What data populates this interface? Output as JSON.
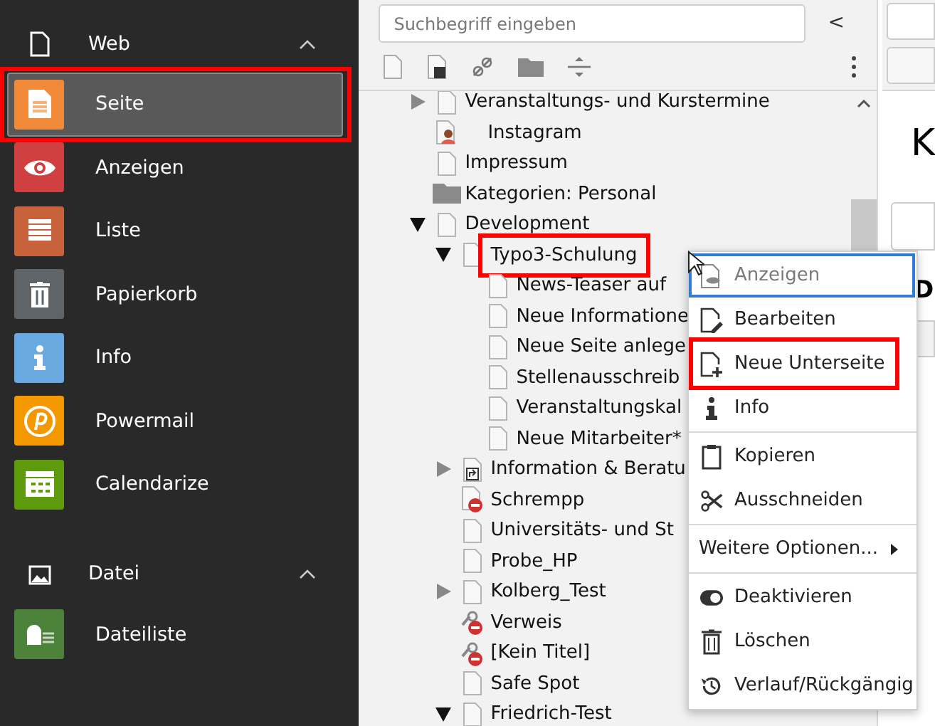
{
  "sidebar": {
    "sections": [
      {
        "title": "Web",
        "expanded": true,
        "kind": "page",
        "items": [
          {
            "label": "Seite",
            "kind": "page",
            "color": "#f08a38",
            "selected": true,
            "highlighted": true
          },
          {
            "label": "Anzeigen",
            "kind": "eye",
            "color": "#d04040",
            "selected": false,
            "highlighted": false
          },
          {
            "label": "Liste",
            "kind": "list",
            "color": "#c8623a",
            "selected": false,
            "highlighted": false
          },
          {
            "label": "Papierkorb",
            "kind": "trash",
            "color": "#5f6468",
            "selected": false,
            "highlighted": false
          },
          {
            "label": "Info",
            "kind": "info",
            "color": "#6aa9e0",
            "selected": false,
            "highlighted": false
          },
          {
            "label": "Powermail",
            "kind": "p",
            "color": "#f39800",
            "selected": false,
            "highlighted": false
          },
          {
            "label": "Calendarize",
            "kind": "calendar",
            "color": "#5d9b0d",
            "selected": false,
            "highlighted": false
          }
        ]
      },
      {
        "title": "Datei",
        "expanded": true,
        "kind": "image",
        "items": [
          {
            "label": "Dateiliste",
            "kind": "cloud",
            "color": "#4c8239",
            "selected": false,
            "highlighted": false
          }
        ]
      }
    ]
  },
  "tree_panel": {
    "search": {
      "placeholder": "Suchbegriff eingeben"
    },
    "collapse_button": "<",
    "nodes": [
      {
        "label": "Veranstaltungs- und Kurstermine",
        "kind": "page",
        "expanded": false,
        "highlighted": false
      },
      {
        "label": "Instagram",
        "kind": "user",
        "highlighted": false
      },
      {
        "label": "Impressum",
        "kind": "page",
        "highlighted": false
      },
      {
        "label": "Kategorien: Personal",
        "kind": "folder",
        "highlighted": false
      },
      {
        "label": "Development",
        "kind": "page",
        "expanded": true,
        "highlighted": false,
        "children": [
          {
            "label": "Typo3-Schulung",
            "kind": "page",
            "expanded": true,
            "highlighted": true,
            "children": [
              {
                "label": "News-Teaser auf",
                "kind": "page",
                "highlighted": false
              },
              {
                "label": "Neue Informatione",
                "kind": "page",
                "highlighted": false
              },
              {
                "label": "Neue Seite anlege",
                "kind": "page",
                "highlighted": false
              },
              {
                "label": "Stellenausschreib",
                "kind": "page",
                "highlighted": false
              },
              {
                "label": "Veranstaltungskal",
                "kind": "page",
                "highlighted": false
              },
              {
                "label": "Neue Mitarbeiter*",
                "kind": "page",
                "highlighted": false
              }
            ]
          },
          {
            "label": "Information & Beratu",
            "kind": "shortcut",
            "expanded": false,
            "highlighted": false
          },
          {
            "label": "Schrempp",
            "kind": "disabled",
            "highlighted": false
          },
          {
            "label": "Universitäts- und St",
            "kind": "page",
            "highlighted": false
          },
          {
            "label": "Probe_HP",
            "kind": "page",
            "highlighted": false
          },
          {
            "label": "Kolberg_Test",
            "kind": "page",
            "expanded": false,
            "highlighted": false
          },
          {
            "label": "Verweis",
            "kind": "link-disabled",
            "highlighted": false
          },
          {
            "label": "[Kein Titel]",
            "kind": "link-disabled",
            "highlighted": false
          },
          {
            "label": "Safe Spot",
            "kind": "page",
            "highlighted": false
          },
          {
            "label": "Friedrich-Test",
            "kind": "page",
            "expanded": true,
            "highlighted": false
          }
        ]
      }
    ]
  },
  "content": {
    "heading": "K",
    "label": "D"
  },
  "context_menu": {
    "groups": [
      [
        {
          "label": "Anzeigen",
          "kind": "view",
          "focused": true,
          "highlighted": false
        },
        {
          "label": "Bearbeiten",
          "kind": "edit",
          "focused": false,
          "highlighted": false
        },
        {
          "label": "Neue Unterseite",
          "kind": "new-page",
          "focused": false,
          "highlighted": true
        },
        {
          "label": "Info",
          "kind": "info",
          "focused": false,
          "highlighted": false
        }
      ],
      [
        {
          "label": "Kopieren",
          "kind": "clipboard",
          "focused": false,
          "highlighted": false
        },
        {
          "label": "Ausschneiden",
          "kind": "scissors",
          "focused": false,
          "highlighted": false
        }
      ],
      [
        {
          "label": "Weitere Optionen...",
          "kind": "submenu",
          "focused": false,
          "highlighted": false
        }
      ],
      [
        {
          "label": "Deaktivieren",
          "kind": "toggle",
          "focused": false,
          "highlighted": false
        },
        {
          "label": "Löschen",
          "kind": "trash",
          "focused": false,
          "highlighted": false
        },
        {
          "label": "Verlauf/Rückgängig",
          "kind": "history",
          "focused": false,
          "highlighted": false
        }
      ]
    ]
  }
}
